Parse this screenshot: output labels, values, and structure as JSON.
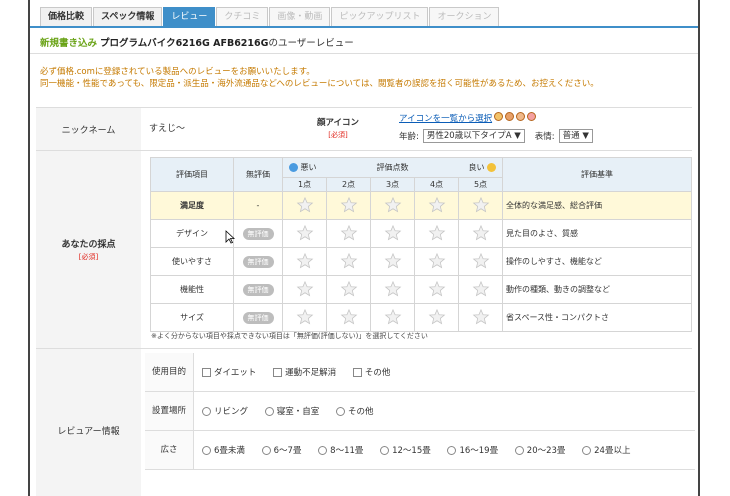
{
  "tabs": [
    {
      "label": "価格比較",
      "state": "normal"
    },
    {
      "label": "スペック情報",
      "state": "normal"
    },
    {
      "label": "レビュー",
      "state": "active"
    },
    {
      "label": "クチコミ",
      "state": "disabled"
    },
    {
      "label": "画像・動画",
      "state": "disabled"
    },
    {
      "label": "ピックアップリスト",
      "state": "disabled"
    },
    {
      "label": "オークション",
      "state": "disabled"
    }
  ],
  "breadcrumb": {
    "prefix": "新規書き込み",
    "product": "プログラムバイク6216G AFB6216G",
    "suffix": "のユーザーレビュー"
  },
  "notice": {
    "line1": "必ず価格.comに登録されている製品へのレビューをお願いいたします。",
    "line2": "同一機能・性能であっても、限定品・派生品・海外流通品などへのレビューについては、閲覧者の誤認を招く可能性があるため、お控えください。"
  },
  "nickname": {
    "label": "ニックネーム",
    "value": "すえじ〜"
  },
  "face_icon": {
    "label": "顔アイコン",
    "required": "[必須]",
    "link": "アイコンを一覧から選択",
    "age_label": "年齢:",
    "age_value": "男性20歳以下タイプA ▼",
    "expr_label": "表情:",
    "expr_value": "普通 ▼"
  },
  "score": {
    "label": "あなたの採点",
    "required": "[必須]",
    "header": {
      "item": "評価項目",
      "none": "無評価",
      "bad": "悪い",
      "points": "評価点数",
      "good": "良い",
      "criteria": "評価基準",
      "cols": [
        "1点",
        "2点",
        "3点",
        "4点",
        "5点"
      ]
    },
    "rows": [
      {
        "item": "満足度",
        "none": "-",
        "criteria": "全体的な満足感、総合評価"
      },
      {
        "item": "デザイン",
        "none": "無評価",
        "criteria": "見た目のよさ、質感"
      },
      {
        "item": "使いやすさ",
        "none": "無評価",
        "criteria": "操作のしやすさ、機能など"
      },
      {
        "item": "機能性",
        "none": "無評価",
        "criteria": "動作の種類、動きの調整など"
      },
      {
        "item": "サイズ",
        "none": "無評価",
        "criteria": "省スペース性・コンパクトさ"
      }
    ],
    "note": "※よく分からない項目や採点できない項目は「無評価(評価しない)」を選択してください"
  },
  "reviewer": {
    "label": "レビュアー情報",
    "rows": [
      {
        "label": "使用目的",
        "type": "checkbox",
        "options": [
          "ダイエット",
          "運動不足解消",
          "その他"
        ]
      },
      {
        "label": "設置場所",
        "type": "radio",
        "options": [
          "リビング",
          "寝室・自室",
          "その他"
        ]
      },
      {
        "label": "広さ",
        "type": "radio",
        "options": [
          "6畳未満",
          "6〜7畳",
          "8〜11畳",
          "12〜15畳",
          "16〜19畳",
          "20〜23畳",
          "24畳以上"
        ]
      }
    ]
  },
  "colors": {
    "accent": "#3f8fc9",
    "green": "#6aa317",
    "notice": "#c57a00",
    "required": "#e0241b",
    "highlight": "#fff9d9"
  }
}
